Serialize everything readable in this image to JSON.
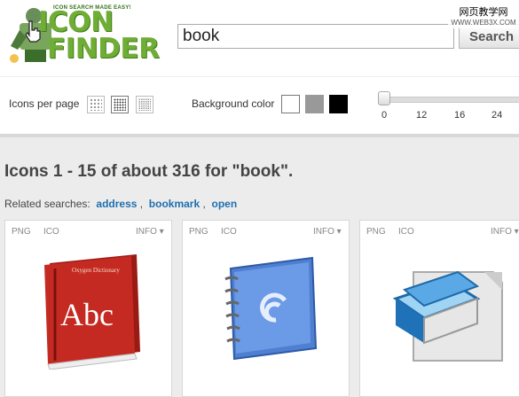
{
  "logo": {
    "tagline": "ICON SEARCH MADE EASY!",
    "word1": "ICON",
    "word2": "FINDER"
  },
  "search": {
    "value": "book",
    "button_label": "Search"
  },
  "watermark": {
    "line1": "网页教学网",
    "line2": "WWW.WEB3X.COM"
  },
  "toolbar": {
    "icons_per_page_label": "Icons per page",
    "background_color_label": "Background color",
    "background_colors": [
      "#ffffff",
      "#999999",
      "#000000"
    ],
    "size_ticks": [
      "0",
      "12",
      "16",
      "24"
    ]
  },
  "results": {
    "title": "Icons 1 - 15 of about 316 for \"book\".",
    "related_label": "Related searches:",
    "related": [
      "address",
      "bookmark",
      "open"
    ],
    "cards": [
      {
        "png": "PNG",
        "ico": "ICO",
        "info": "INFO",
        "icon": "dictionary-book-icon",
        "book_text": "Abc",
        "book_subtitle": "Oxygen Dictionary"
      },
      {
        "png": "PNG",
        "ico": "ICO",
        "info": "INFO",
        "icon": "address-book-icon"
      },
      {
        "png": "PNG",
        "ico": "ICO",
        "info": "INFO",
        "icon": "book-document-icon"
      }
    ]
  }
}
